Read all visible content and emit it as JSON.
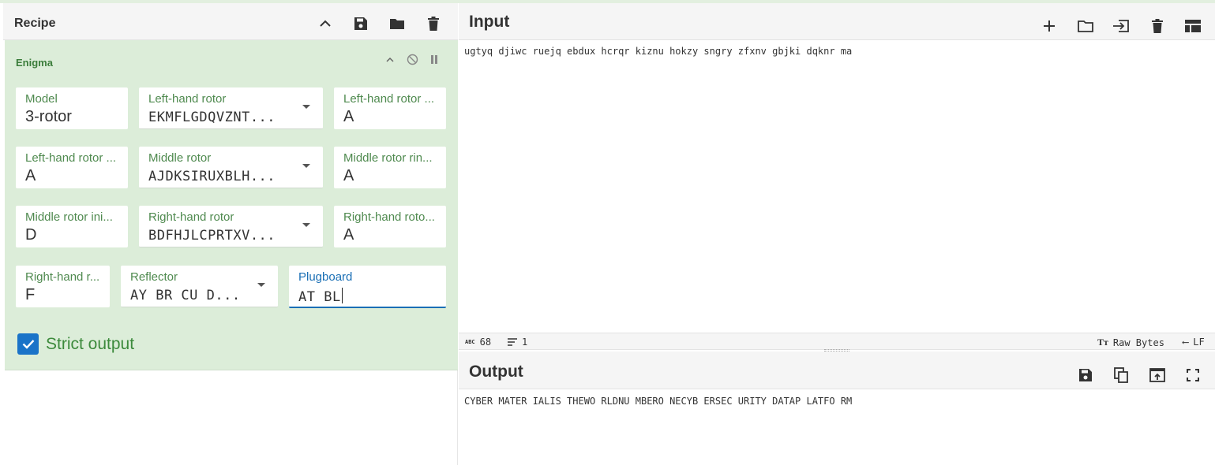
{
  "recipe": {
    "title": "Recipe",
    "header_icons": [
      "chevron-up-icon",
      "save-icon",
      "folder-icon",
      "trash-icon"
    ]
  },
  "operation": {
    "name": "Enigma",
    "fields": {
      "model": {
        "label": "Model",
        "value": "3-rotor"
      },
      "left_rotor": {
        "label": "Left-hand rotor",
        "value": "EKMFLGDQVZNT..."
      },
      "left_ring": {
        "label": "Left-hand rotor ...",
        "value": "A"
      },
      "left_initial": {
        "label": "Left-hand rotor ...",
        "value": "A"
      },
      "middle_rotor": {
        "label": "Middle rotor",
        "value": "AJDKSIRUXBLH..."
      },
      "middle_ring": {
        "label": "Middle rotor rin...",
        "value": "A"
      },
      "middle_initial": {
        "label": "Middle rotor ini...",
        "value": "D"
      },
      "right_rotor": {
        "label": "Right-hand rotor",
        "value": "BDFHJLCPRTXV..."
      },
      "right_ring": {
        "label": "Right-hand roto...",
        "value": "A"
      },
      "right_initial": {
        "label": "Right-hand r...",
        "value": "F"
      },
      "reflector": {
        "label": "Reflector",
        "value": "AY BR CU D..."
      },
      "plugboard": {
        "label": "Plugboard",
        "value": "AT BL"
      }
    },
    "strict_output": {
      "label": "Strict output",
      "checked": true
    }
  },
  "input": {
    "title": "Input",
    "text": "ugtyq djiwc ruejq ebdux hcrqr kiznu hokzy sngry zfxnv gbjki dqknr ma"
  },
  "status": {
    "length": "68",
    "lines": "1",
    "encoding": "Raw Bytes",
    "eol": "LF"
  },
  "output": {
    "title": "Output",
    "text": "CYBER MATER IALIS THEWO RLDNU MBERO NECYB ERSEC URITY DATAP LATFO RM"
  },
  "colors": {
    "op_bg": "#dcedd9",
    "label_green": "#4f8a4f",
    "accent_blue": "#1a73c8"
  }
}
